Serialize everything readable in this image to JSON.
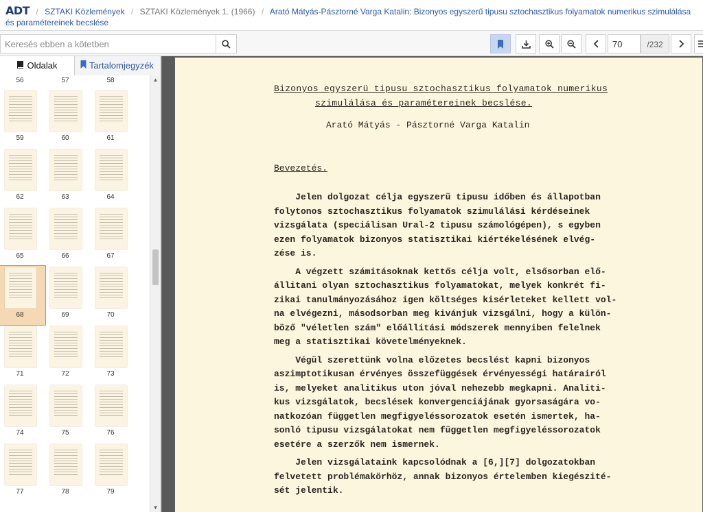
{
  "breadcrumb": {
    "logo": "ADT",
    "items": [
      "SZTAKI Közlemények",
      "SZTAKI Közlemények 1. (1966)",
      "Arató Mátyás-Pásztorné Varga Katalin: Bizonyos egyszerű tipusu sztochasztikus folyamatok numerikus szimulálása és paramétereinek becslése"
    ]
  },
  "toolbar": {
    "search_placeholder": "Keresés ebben a kötetben",
    "current_page": "70",
    "total_pages": "/232"
  },
  "sidebar": {
    "tab_pages": "Oldalak",
    "tab_toc": "Tartalomjegyzék",
    "top_row": [
      "56",
      "57",
      "58"
    ],
    "rows": [
      [
        "59",
        "60",
        "61"
      ],
      [
        "62",
        "63",
        "64"
      ],
      [
        "65",
        "66",
        "67"
      ],
      [
        "68",
        "69",
        "70"
      ],
      [
        "71",
        "72",
        "73"
      ],
      [
        "74",
        "75",
        "76"
      ],
      [
        "77",
        "78",
        "79"
      ]
    ],
    "selected": "68"
  },
  "document": {
    "title_line1": "Bizonyos egyszerü tipusu sztochasztikus folyamatok numerikus",
    "title_line2": "szimulálása és paramétereinek becslése.",
    "authors": "Arató Mátyás - Pásztorné Varga Katalin",
    "heading": "Bevezetés.",
    "paragraphs": [
      "    Jelen dolgozat célja egyszerü tipusu időben és állapotban\nfolytonos sztochasztikus folyamatok szimulálási kérdéseinek\nvizsgálata (speciálisan Ural-2 tipusu számológépen), s egyben\nezen folyamatok bizonyos statisztikai kiértékelésének elvég-\nzése is.",
      "    A végzett számitásoknak kettős célja volt, elsősorban elő-\nállitani olyan sztochasztikus folyamatokat, melyek konkrét fi-\nzikai tanulmányozásához igen költséges kisérleteket kellett vol-\nna elvégezni, másodsorban meg kivánjuk vizsgálni, hogy a külön-\nböző \"véletlen szám\" előállitási módszerek mennyiben felelnek\nmeg a statisztikai követelményeknek.",
      "    Végül szerettünk volna előzetes becslést kapni bizonyos\naszimptotikusan érvényes összefüggések érvényességi határairól\nis, melyeket analitikus uton jóval nehezebb megkapni. Analiti-\nkus vizsgálatok, becslések konvergenciájának gyorsaságára vo-\nnatkozóan független megfigyeléssorozatok esetén ismertek, ha-\nsonló tipusu vizsgálatokat nem független megfigyeléssorozatok\nesetére a szerzők nem ismernek.",
      "    Jelen vizsgálataink kapcsolódnak a [6,][7] dolgozatokban\nfelvetett problémakörhöz, annak bizonyos értelemben kiegészité-\nsét jelentik."
    ]
  }
}
